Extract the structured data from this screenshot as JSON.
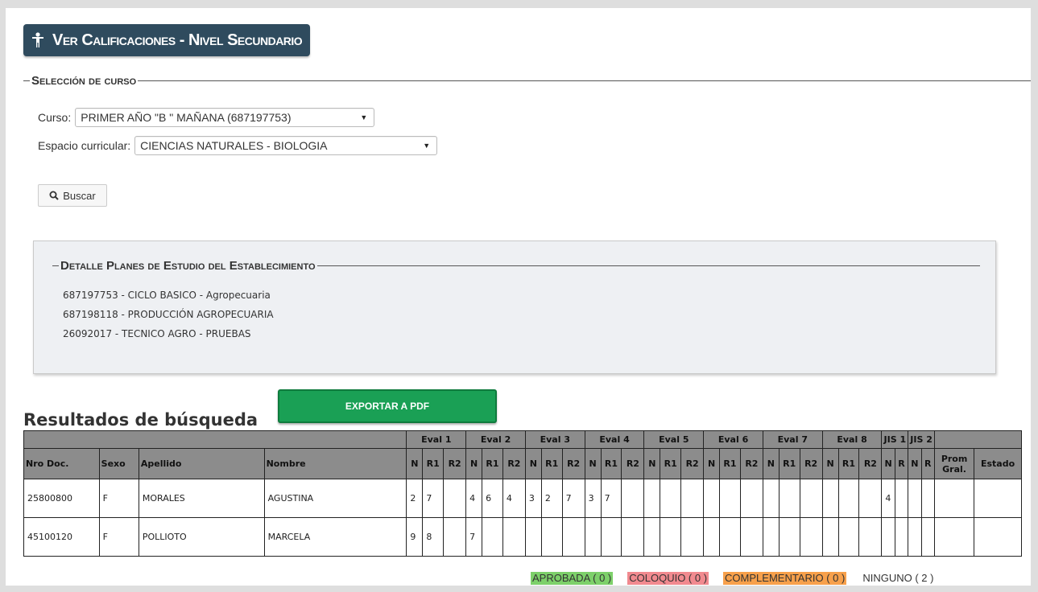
{
  "header": {
    "title": "Ver Calificaciones - Nivel Secundario",
    "icon": "person-icon"
  },
  "course_selection": {
    "legend": "Selección de curso",
    "curso_label": "Curso:",
    "curso_value": "PRIMER AÑO \"B \" MAÑANA (687197753)",
    "espacio_label": "Espacio curricular:",
    "espacio_value": "CIENCIAS NATURALES - BIOLOGIA",
    "search_button": "Buscar"
  },
  "plans": {
    "legend": "Detalle Planes de Estudio del Establecimiento",
    "items": [
      "687197753 - CICLO BASICO - Agropecuaria",
      "687198118 - PRODUCCIÓN AGROPECUARIA",
      "26092017 - TECNICO AGRO - PRUEBAS"
    ]
  },
  "results": {
    "title": "Resultados de búsqueda",
    "export_button": "EXPORTAR A PDF",
    "columns": {
      "nro_doc": "Nro Doc.",
      "sexo": "Sexo",
      "apellido": "Apellido",
      "nombre": "Nombre",
      "prom": "Prom Gral.",
      "estado": "Estado",
      "eval_groups": [
        "Eval 1",
        "Eval 2",
        "Eval 3",
        "Eval 4",
        "Eval 5",
        "Eval 6",
        "Eval 7",
        "Eval 8"
      ],
      "eval_sub": [
        "N",
        "R1",
        "R2"
      ],
      "jis_groups": [
        "JIS 1",
        "JIS 2"
      ],
      "jis_sub": [
        "N",
        "R"
      ]
    },
    "rows": [
      {
        "nro_doc": "25800800",
        "sexo": "F",
        "apellido": "MORALES",
        "nombre": "AGUSTINA",
        "evals": [
          [
            "2",
            "7",
            ""
          ],
          [
            "4",
            "6",
            "4"
          ],
          [
            "3",
            "2",
            "7"
          ],
          [
            "3",
            "7",
            ""
          ],
          [
            "",
            "",
            ""
          ],
          [
            "",
            "",
            ""
          ],
          [
            "",
            "",
            ""
          ],
          [
            "",
            "",
            ""
          ]
        ],
        "jis": [
          [
            "4",
            ""
          ],
          [
            "",
            ""
          ]
        ],
        "prom": "",
        "estado": ""
      },
      {
        "nro_doc": "45100120",
        "sexo": "F",
        "apellido": "POLLIOTO",
        "nombre": "MARCELA",
        "evals": [
          [
            "9",
            "8",
            ""
          ],
          [
            "7",
            "",
            ""
          ],
          [
            "",
            "",
            ""
          ],
          [
            "",
            "",
            ""
          ],
          [
            "",
            "",
            ""
          ],
          [
            "",
            "",
            ""
          ],
          [
            "",
            "",
            ""
          ],
          [
            "",
            "",
            ""
          ]
        ],
        "jis": [
          [
            "",
            ""
          ],
          [
            "",
            ""
          ]
        ],
        "prom": "",
        "estado": ""
      }
    ]
  },
  "legend": {
    "aprobada": "APROBADA ( 0 )",
    "coloquio": "COLOQUIO ( 0 )",
    "complementario": "COMPLEMENTARIO ( 0 )",
    "ninguno": "NINGUNO ( 2 )"
  },
  "colors": {
    "header_bg": "#2f4b5e",
    "table_header_bg": "#8c8c8c",
    "export_green": "#1aa055",
    "aprobada": "#7dd06a",
    "coloquio": "#f18a8f",
    "complementario": "#f7a04b"
  }
}
